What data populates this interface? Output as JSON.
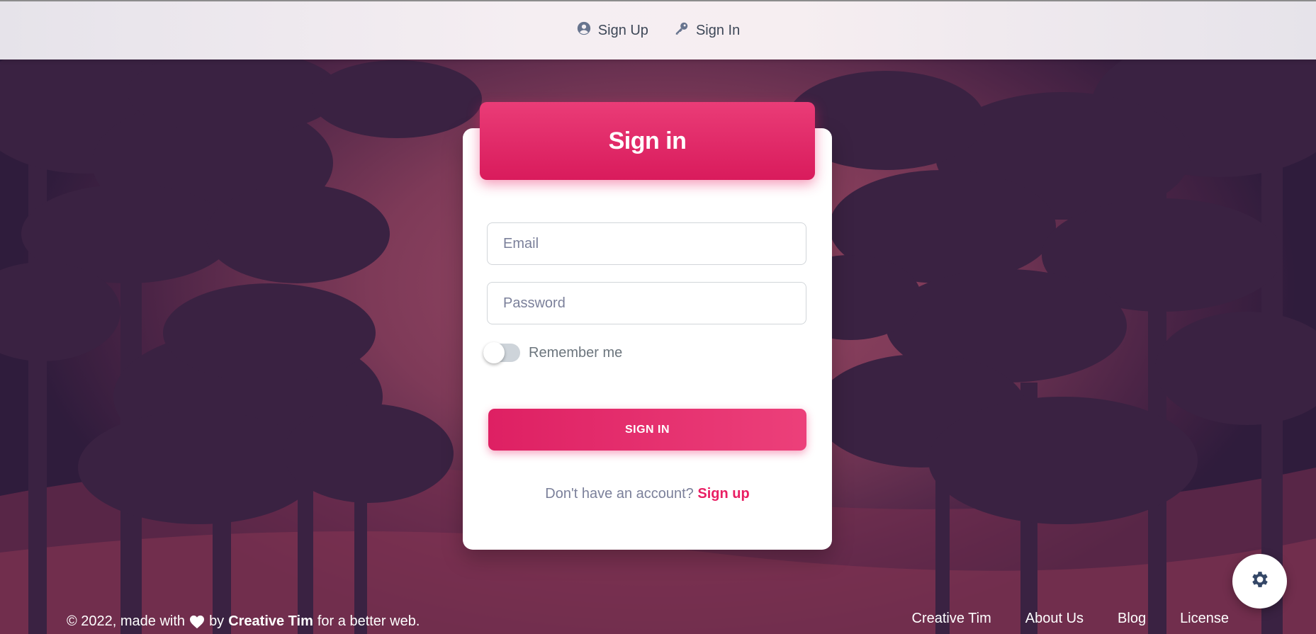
{
  "navbar": {
    "links": [
      {
        "label": "Sign Up",
        "icon": "account-circle-icon"
      },
      {
        "label": "Sign In",
        "icon": "key-icon"
      }
    ]
  },
  "card": {
    "title": "Sign in",
    "email_placeholder": "Email",
    "password_placeholder": "Password",
    "remember_label": "Remember me",
    "remember_on": false,
    "submit_label": "SIGN IN",
    "signup_prompt": "Don't have an account?",
    "signup_link": "Sign up"
  },
  "footer": {
    "copyright_prefix": "© 2022, made with",
    "by": "by",
    "author": "Creative Tim",
    "suffix": "for a better web.",
    "links": [
      "Creative Tim",
      "About Us",
      "Blog",
      "License"
    ]
  },
  "settings": {
    "icon": "gear-icon"
  },
  "colors": {
    "accent": "#e91e63",
    "text_muted": "#7b809a",
    "nav_text": "#3d4757"
  }
}
